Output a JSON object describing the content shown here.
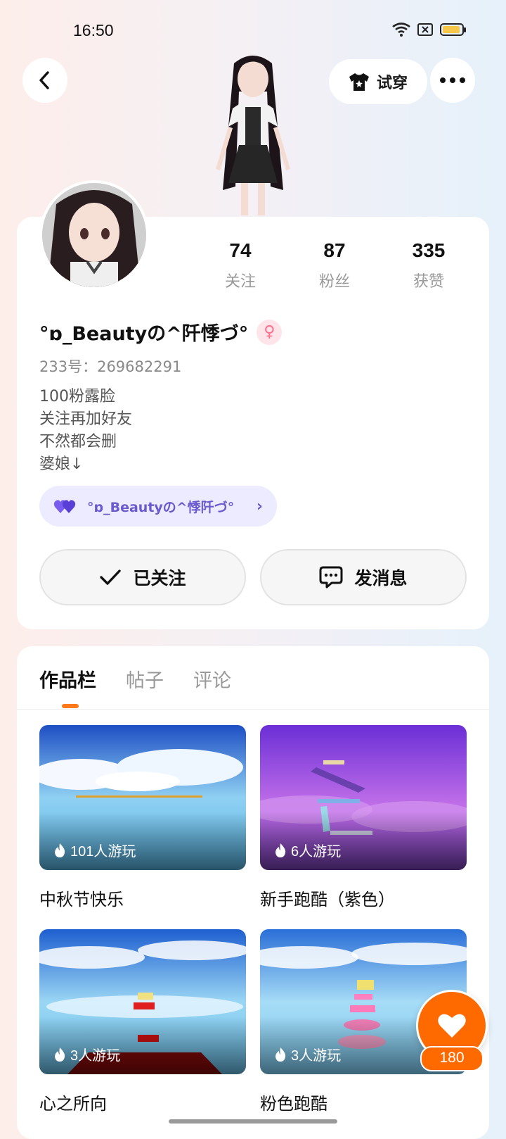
{
  "status_bar": {
    "time": "16:50"
  },
  "header": {
    "try_on_label": "试穿"
  },
  "stats": [
    {
      "value": "74",
      "label": "关注"
    },
    {
      "value": "87",
      "label": "粉丝"
    },
    {
      "value": "335",
      "label": "获赞"
    }
  ],
  "profile": {
    "nickname": "°ɒ_Beautyの^阡悸づ°",
    "gender_symbol": "♀",
    "uid_line": "233号：269682291",
    "bio": [
      "100粉露脸",
      "关注再加好友",
      "不然都会删",
      "婆娘↓"
    ],
    "friend_chip": "°ɒ_Beautyの^悸阡づ°"
  },
  "actions": {
    "follow_label": "已关注",
    "message_label": "发消息"
  },
  "tabs": [
    "作品栏",
    "帖子",
    "评论"
  ],
  "works": [
    {
      "title": "中秋节快乐",
      "plays": "101人游玩"
    },
    {
      "title": "新手跑酷（紫色）",
      "plays": "6人游玩"
    },
    {
      "title": "心之所向",
      "plays": "3人游玩"
    },
    {
      "title": "粉色跑酷",
      "plays": "3人游玩"
    }
  ],
  "like": {
    "count": "180"
  },
  "colors": {
    "accent": "#ff6a00",
    "chip_bg": "#ecebff",
    "chip_text": "#6a5acd"
  }
}
